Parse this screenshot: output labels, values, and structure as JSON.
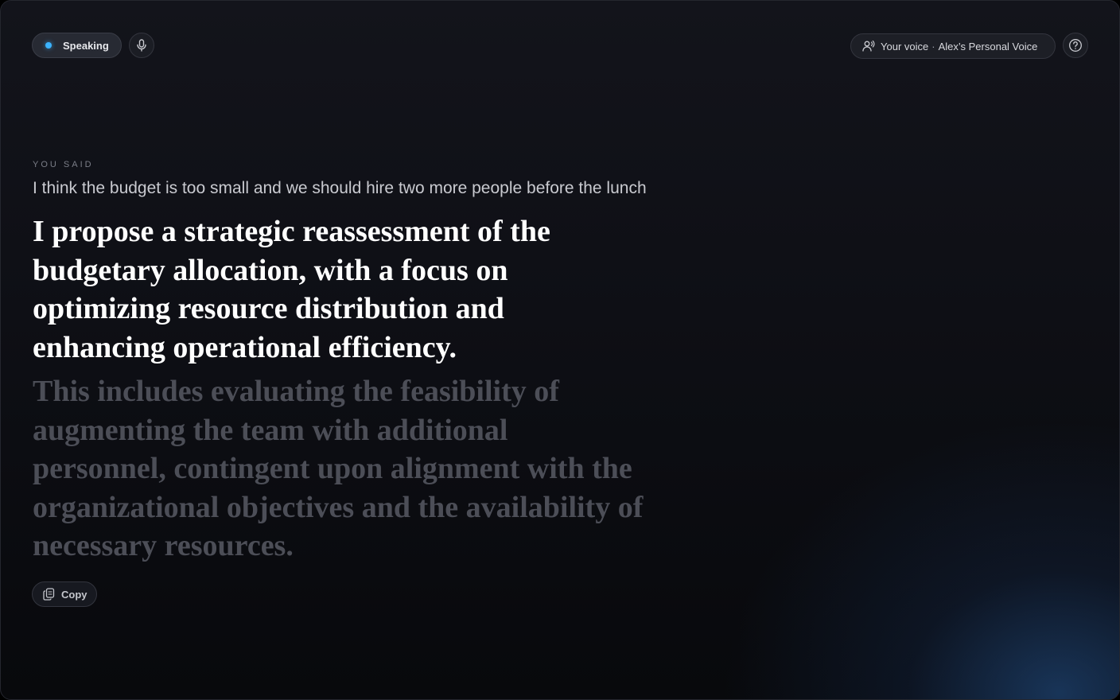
{
  "header": {
    "status_label": "Speaking",
    "voice_prefix": "Your voice",
    "voice_separator": "·",
    "voice_name": "Alex’s Personal Voice"
  },
  "icons": {
    "status": "status-dot-icon",
    "mic": "microphone-icon",
    "voice": "voice-profile-icon",
    "help": "help-icon",
    "copy": "copy-icon"
  },
  "transcript": {
    "label": "YOU SAID",
    "original": "I think the budget is too small and we should hire two more people before the lunch"
  },
  "rewrite": {
    "spoken": "I propose a strategic reassessment of the budgetary allocation, with a focus on optimizing resource distribution and enhancing operational efficiency.",
    "pending": "This includes evaluating the feasibility of augmenting the team with additional personnel, contingent upon alignment with the organizational objectives and the availability of necessary resources."
  },
  "actions": {
    "copy_label": "Copy"
  },
  "colors": {
    "accent": "#3bb3ff",
    "spoken_text": "#ffffff",
    "pending_text": "#4c4e57",
    "background": "#0e0f15"
  }
}
